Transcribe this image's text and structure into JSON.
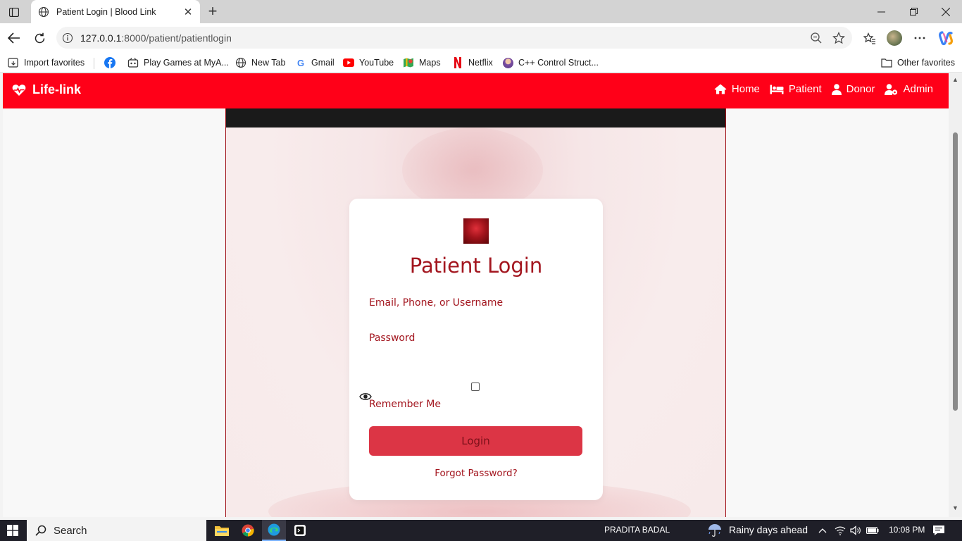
{
  "browser": {
    "tab_title": "Patient Login | Blood Link",
    "url_host": "127.0.0.1",
    "url_path": ":8000/patient/patientlogin",
    "bookmarks": [
      {
        "label": "Import favorites",
        "icon": "import-icon"
      },
      {
        "label": "",
        "icon": "facebook-icon"
      },
      {
        "label": "Play Games at MyA...",
        "icon": "games-icon"
      },
      {
        "label": "New Tab",
        "icon": "globe-icon"
      },
      {
        "label": "Gmail",
        "icon": "google-icon"
      },
      {
        "label": "YouTube",
        "icon": "youtube-icon"
      },
      {
        "label": "Maps",
        "icon": "maps-icon"
      },
      {
        "label": "Netflix",
        "icon": "netflix-icon"
      },
      {
        "label": "C++ Control Struct...",
        "icon": "avatar-icon"
      }
    ],
    "other_favorites": "Other favorites"
  },
  "site": {
    "brand": "Life-link",
    "nav": [
      {
        "label": "Home",
        "icon": "home-icon"
      },
      {
        "label": "Patient",
        "icon": "bed-icon"
      },
      {
        "label": "Donor",
        "icon": "user-icon"
      },
      {
        "label": "Admin",
        "icon": "user-cog-icon"
      }
    ]
  },
  "login": {
    "title": "Patient Login",
    "username_label": "Email, Phone, or Username",
    "password_label": "Password",
    "remember_label": "Remember Me",
    "login_button": "Login",
    "forgot_link": "Forgot Password?"
  },
  "taskbar": {
    "search_label": "Search",
    "user_name": "PRADITA BADAL",
    "weather": "Rainy days ahead",
    "time": "10:08 PM"
  },
  "colors": {
    "navbar": "#ff0018",
    "accent": "#a3161f",
    "button": "#dc3545"
  }
}
